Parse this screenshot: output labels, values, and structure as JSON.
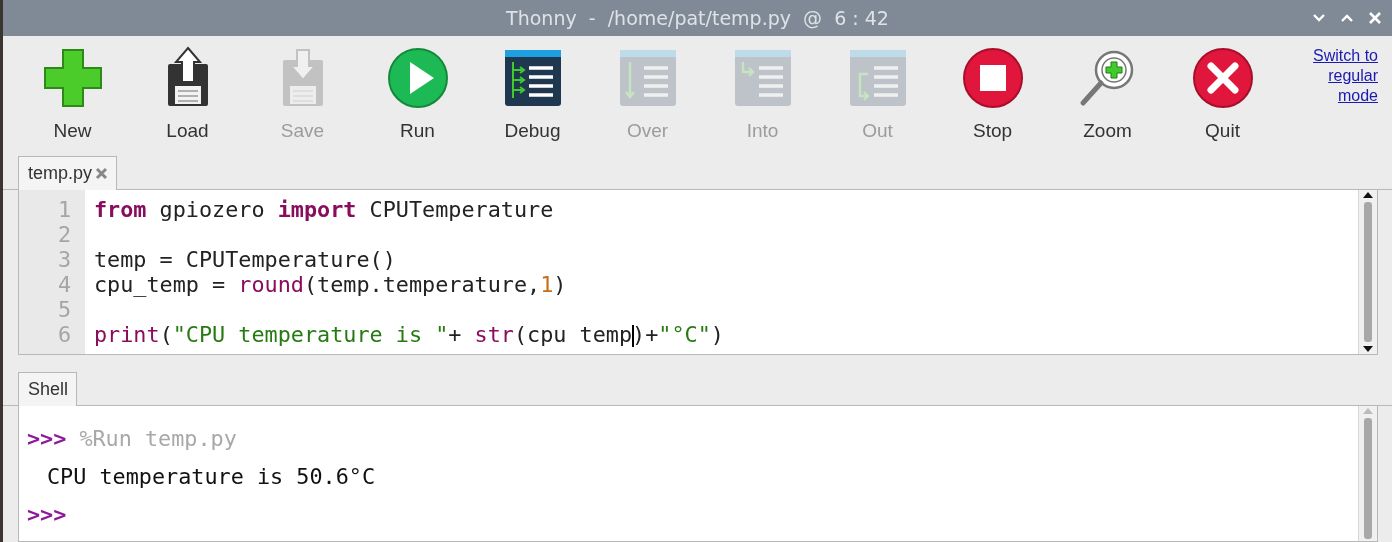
{
  "window": {
    "title": "Thonny  -  /home/pat/temp.py  @  6 : 42"
  },
  "toolbar": {
    "buttons": [
      {
        "label": "New",
        "kind": "new",
        "disabled": false
      },
      {
        "label": "Load",
        "kind": "load",
        "disabled": false
      },
      {
        "label": "Save",
        "kind": "save",
        "disabled": true
      },
      {
        "label": "Run",
        "kind": "run",
        "disabled": false
      },
      {
        "label": "Debug",
        "kind": "debug",
        "disabled": false
      },
      {
        "label": "Over",
        "kind": "over",
        "disabled": true
      },
      {
        "label": "Into",
        "kind": "into",
        "disabled": true
      },
      {
        "label": "Out",
        "kind": "out",
        "disabled": true
      },
      {
        "label": "Stop",
        "kind": "stop",
        "disabled": false
      },
      {
        "label": "Zoom",
        "kind": "zoom",
        "disabled": false
      },
      {
        "label": "Quit",
        "kind": "quit",
        "disabled": false
      }
    ],
    "mode_link": "Switch to regular mode"
  },
  "editor": {
    "tabs": [
      {
        "label": "temp.py",
        "selected": true
      }
    ],
    "lines": [
      {
        "number": "1",
        "tokens": [
          {
            "kind": "keyword",
            "text": "from"
          },
          {
            "kind": "plain",
            "text": " gpiozero "
          },
          {
            "kind": "keyword",
            "text": "import"
          },
          {
            "kind": "plain",
            "text": " CPUTemperature"
          }
        ]
      },
      {
        "number": "2"
      },
      {
        "number": "3",
        "tokens": [
          {
            "kind": "plain",
            "text": "temp = CPUTemperature()"
          }
        ]
      },
      {
        "number": "4",
        "tokens": [
          {
            "kind": "plain",
            "text": "cpu_temp = "
          },
          {
            "kind": "builtin",
            "text": "round"
          },
          {
            "kind": "plain",
            "text": "(temp.temperature,"
          },
          {
            "kind": "number",
            "text": "1"
          },
          {
            "kind": "plain",
            "text": ")"
          }
        ]
      },
      {
        "number": "5"
      },
      {
        "number": "6",
        "tokens": [
          {
            "kind": "builtin",
            "text": "print"
          },
          {
            "kind": "plain",
            "text": "("
          },
          {
            "kind": "string",
            "text": "\"CPU temperature is \""
          },
          {
            "kind": "plain",
            "text": "+ "
          },
          {
            "kind": "builtin",
            "text": "str"
          },
          {
            "kind": "plain",
            "text": "(cpu temp"
          },
          {
            "kind": "caret"
          },
          {
            "kind": "plain",
            "text": ")+"
          },
          {
            "kind": "string",
            "text": "\"°C\""
          },
          {
            "kind": "plain",
            "text": ")"
          }
        ]
      }
    ]
  },
  "shell": {
    "tabs": [
      {
        "label": "Shell",
        "selected": true
      }
    ],
    "lines": [
      {
        "kind": "prompt",
        "prompt": ">>>",
        "text": "%Run temp.py"
      },
      {
        "kind": "output",
        "text": "CPU temperature is 50.6°C"
      },
      {
        "kind": "prompt",
        "prompt": ">>>"
      }
    ]
  }
}
